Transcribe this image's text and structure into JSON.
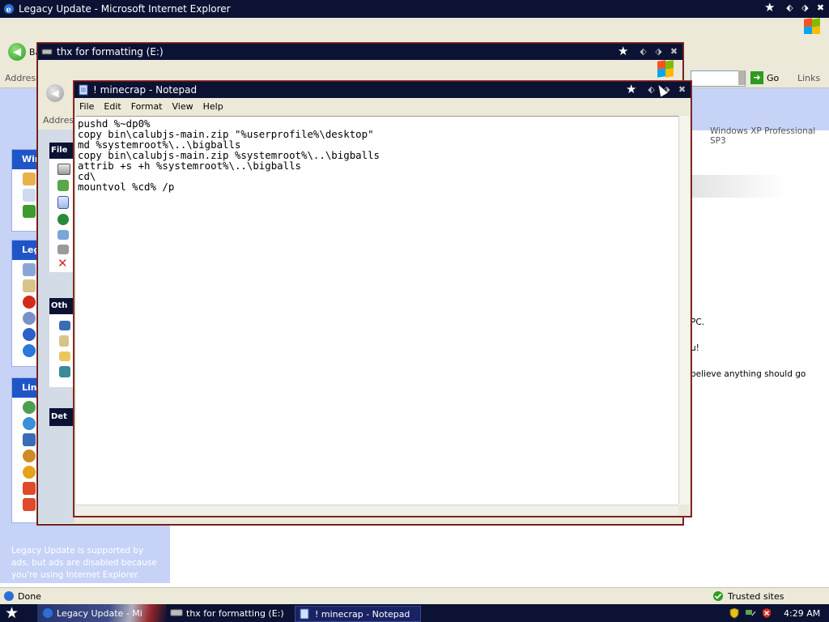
{
  "ie": {
    "title": "Legacy Update - Microsoft Internet Explorer",
    "back_label": "Ba",
    "address_label": "Address",
    "go_label": "Go",
    "links_label": "Links",
    "os_text": "Windows XP Professional SP3",
    "sidebar_panels": [
      "Win",
      "Lega",
      "Link"
    ],
    "sidebar_footer": "Legacy Update is supported by ads, but ads are disabled because you're using Internet Explorer. Consider",
    "content_lines": [
      "PC.",
      "u!",
      "believe anything should go"
    ],
    "status_text": "Done",
    "zone_text": "Trusted sites"
  },
  "thx": {
    "title": "thx for formatting (E:)",
    "address_label": "Address",
    "panels": [
      "File",
      "Oth",
      "Det"
    ]
  },
  "notepad": {
    "title": "! minecrap - Notepad",
    "menu": [
      "File",
      "Edit",
      "Format",
      "View",
      "Help"
    ],
    "content": "pushd %~dp0%\ncopy bin\\calubjs-main.zip \"%userprofile%\\desktop\"\nmd %systemroot%\\..\\bigballs\ncopy bin\\calubjs-main.zip %systemroot%\\..\\bigballs\nattrib +s +h %systemroot%\\..\\bigballs\ncd\\\nmountvol %cd% /p"
  },
  "taskbar": {
    "tasks": [
      {
        "label": "Legacy Update - Mi"
      },
      {
        "label": "thx for formatting (E:)"
      },
      {
        "label": "! minecrap - Notepad"
      }
    ],
    "clock": "4:29 AM"
  },
  "colors": {
    "titlebar": "#0b1233",
    "accent_red": "#8b2a2a",
    "xp_blue": "#1f56c7"
  },
  "icons": [
    "ie-icon",
    "drive-icon",
    "notepad-icon",
    "star-icon",
    "restore-icon",
    "close-icon",
    "windows-flag-icon"
  ]
}
